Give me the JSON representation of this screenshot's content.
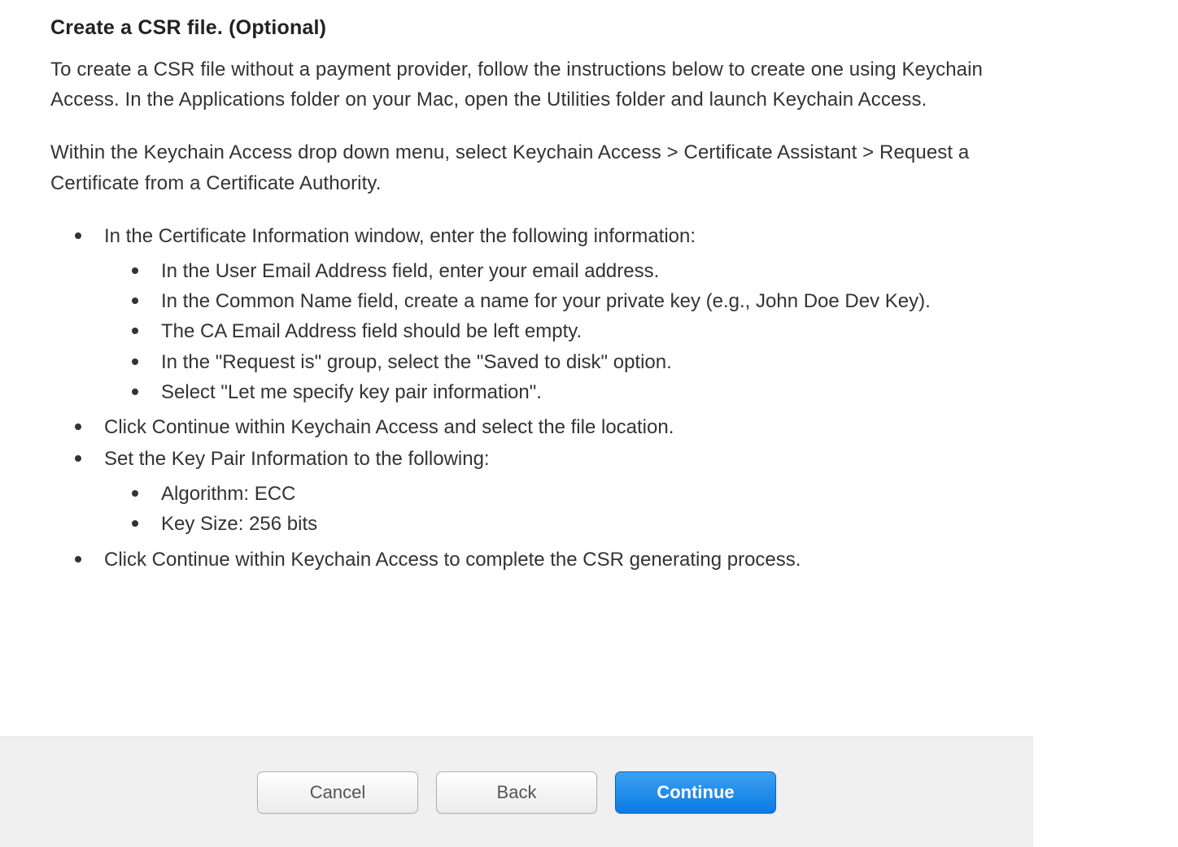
{
  "heading": "Create a CSR file. (Optional)",
  "paragraphs": [
    "To create a CSR file without a payment provider, follow the instructions below to create one using Keychain Access. In the Applications folder on your Mac, open the Utilities folder and launch Keychain Access.",
    "Within the Keychain Access drop down menu, select Keychain Access > Certificate Assistant > Request a Certificate from a Certificate Authority."
  ],
  "list": [
    {
      "text": "In the Certificate Information window, enter the following information:",
      "children": [
        "In the User Email Address field, enter your email address.",
        "In the Common Name field, create a name for your private key (e.g., John Doe Dev Key).",
        "The CA Email Address field should be left empty.",
        "In the \"Request is\" group, select the \"Saved to disk\" option.",
        "Select \"Let me specify key pair information\"."
      ]
    },
    {
      "text": "Click Continue within Keychain Access and select the file location."
    },
    {
      "text": "Set the Key Pair Information to the following:",
      "children": [
        "Algorithm: ECC",
        "Key Size: 256 bits"
      ]
    },
    {
      "text": "Click Continue within Keychain Access to complete the CSR generating process."
    }
  ],
  "buttons": {
    "cancel": "Cancel",
    "back": "Back",
    "continue": "Continue"
  }
}
